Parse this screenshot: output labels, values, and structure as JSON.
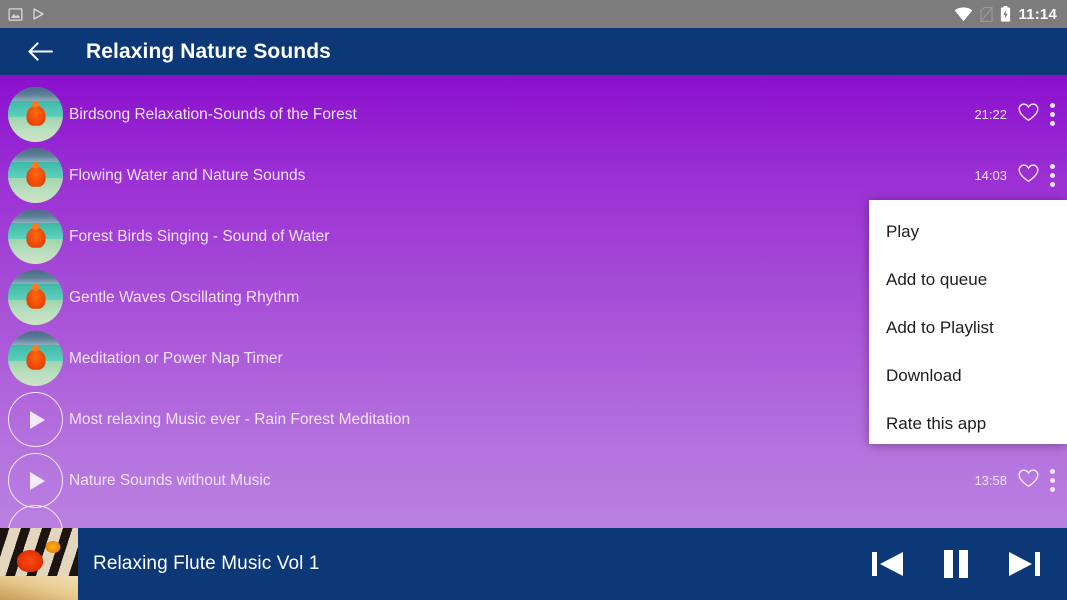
{
  "statusbar": {
    "time": "11:14",
    "left_icons": [
      {
        "name": "screenshot-icon"
      },
      {
        "name": "play-indicator-icon"
      }
    ],
    "right_icons": [
      {
        "name": "wifi-icon"
      },
      {
        "name": "sim-card-icon"
      },
      {
        "name": "battery-charging-icon"
      }
    ],
    "background_color": "#7c7c7c"
  },
  "appbar": {
    "title": "Relaxing Nature Sounds",
    "back_icon": "back-arrow-icon",
    "background_color": "#0d3878"
  },
  "list": {
    "gradient_top": "#8a10cd",
    "gradient_bottom": "#ba80e1",
    "items": [
      {
        "title": "Birdsong Relaxation-Sounds of the Forest",
        "duration": "21:22",
        "art": "thumbnail",
        "favorite": false
      },
      {
        "title": "Flowing Water and Nature Sounds",
        "duration": "14:03",
        "art": "thumbnail",
        "favorite": false
      },
      {
        "title": "Forest Birds Singing - Sound of Water",
        "duration": "",
        "art": "thumbnail",
        "favorite": false
      },
      {
        "title": "Gentle Waves Oscillating Rhythm",
        "duration": "",
        "art": "thumbnail",
        "favorite": false
      },
      {
        "title": "Meditation or Power Nap Timer",
        "duration": "",
        "art": "thumbnail",
        "favorite": false
      },
      {
        "title": "Most relaxing Music ever - Rain Forest Meditation",
        "duration": "",
        "art": "play-circle",
        "favorite": false
      },
      {
        "title": "Nature Sounds without Music",
        "duration": "13:58",
        "art": "play-circle",
        "favorite": false
      }
    ]
  },
  "menu": {
    "items": [
      {
        "label": "Play"
      },
      {
        "label": "Add to queue"
      },
      {
        "label": "Add to Playlist"
      },
      {
        "label": "Download"
      },
      {
        "label": "Rate this app"
      }
    ],
    "background_color": "#ffffff"
  },
  "player": {
    "title": "Relaxing Flute Music Vol 1",
    "background_color": "#0d3878",
    "controls": [
      {
        "name": "previous-button"
      },
      {
        "name": "pause-button"
      },
      {
        "name": "next-button"
      }
    ]
  }
}
